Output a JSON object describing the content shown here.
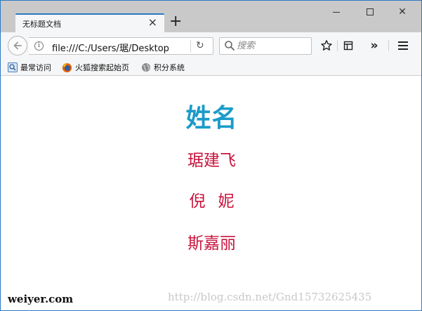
{
  "window": {
    "tab_title": "无标题文档",
    "tab_close_icon": "×",
    "new_tab_icon": "+",
    "minimize_icon": "minimize-icon",
    "maximize_icon": "maximize-icon",
    "close_icon": "✕"
  },
  "navbar": {
    "url": "file:///C:/Users/琚/Desktop",
    "search_placeholder": "搜索",
    "reload_icon": "↻",
    "overflow_label": "»"
  },
  "bookmarks": {
    "items": [
      {
        "label": "最常访问",
        "icon": "most-visited-icon"
      },
      {
        "label": "火狐搜索起始页",
        "icon": "firefox-icon"
      },
      {
        "label": "积分系统",
        "icon": "globe-icon"
      }
    ]
  },
  "page": {
    "title": "姓名",
    "names": [
      "琚建飞",
      "倪妮",
      "斯嘉丽"
    ]
  },
  "watermarks": {
    "left": "weiyer.com",
    "right": "http://blog.csdn.net/Gnd15732625435"
  },
  "colors": {
    "accent_blue": "#2b79c2",
    "title_color": "#1c9bc9",
    "name_color": "#c8143c"
  }
}
